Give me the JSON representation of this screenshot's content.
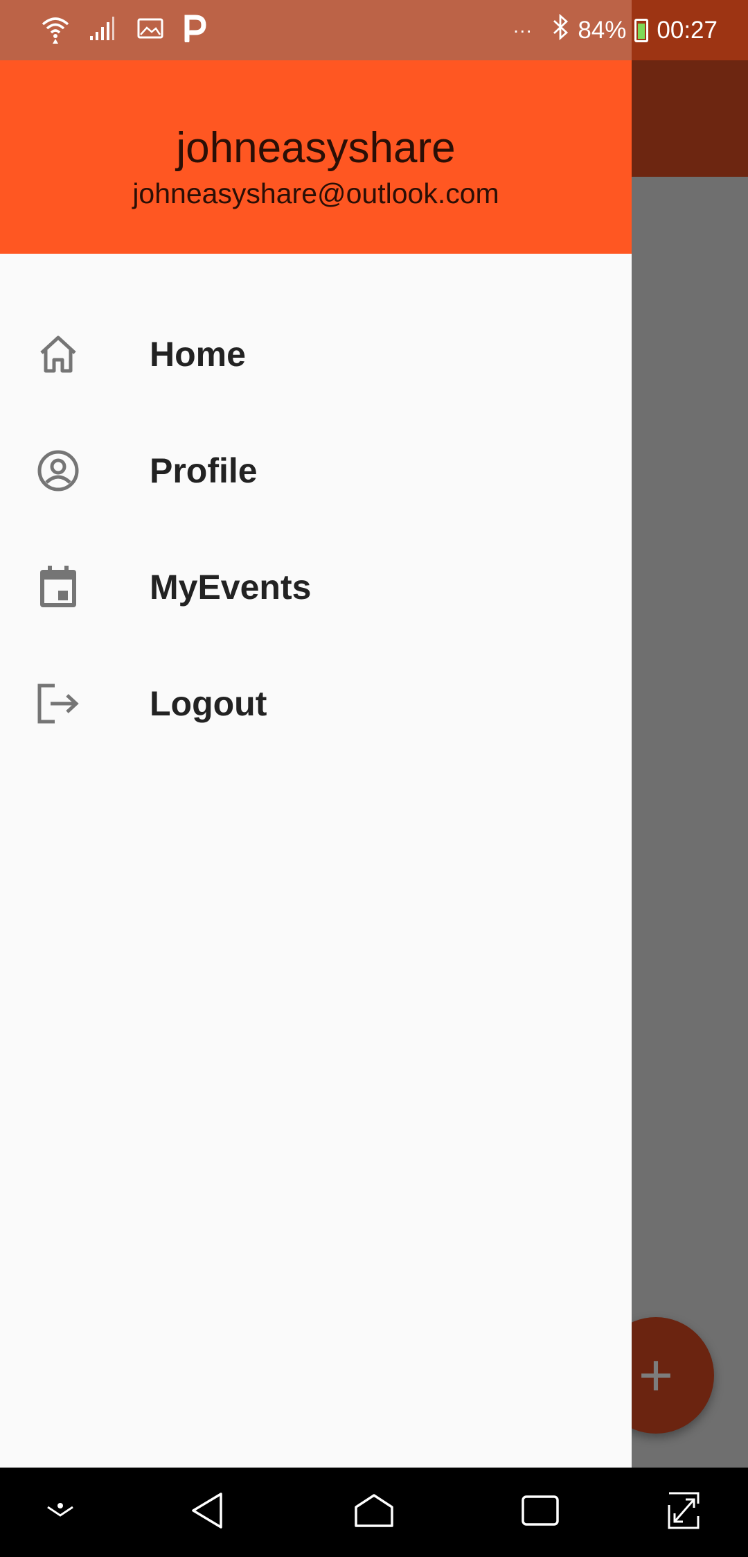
{
  "status_bar": {
    "battery_percent": "84%",
    "time": "00:27",
    "more_indicator": "···",
    "icons": [
      "wifi-icon",
      "signal-icon",
      "gallery-icon",
      "parking-app-icon",
      "bluetooth-icon",
      "battery-charging-icon"
    ]
  },
  "drawer": {
    "header": {
      "username": "johneasyshare",
      "email": "johneasyshare@outlook.com"
    },
    "items": [
      {
        "label": "Home",
        "icon": "home-icon"
      },
      {
        "label": "Profile",
        "icon": "account-circle-icon"
      },
      {
        "label": "MyEvents",
        "icon": "event-calendar-icon"
      },
      {
        "label": "Logout",
        "icon": "logout-icon"
      }
    ]
  },
  "fab": {
    "symbol": "+",
    "icon": "add-icon"
  },
  "nav_bar": {
    "buttons": [
      "hide-nav-icon",
      "back-icon",
      "home-icon",
      "recents-icon",
      "rotate-screen-icon"
    ]
  },
  "colors": {
    "header_accent": "#ff5722",
    "status_bar": "#c4441b",
    "drawer_background": "#fafafa",
    "scrim_gray": "#6f6f6f",
    "fab_dimmed": "#6b2410"
  }
}
